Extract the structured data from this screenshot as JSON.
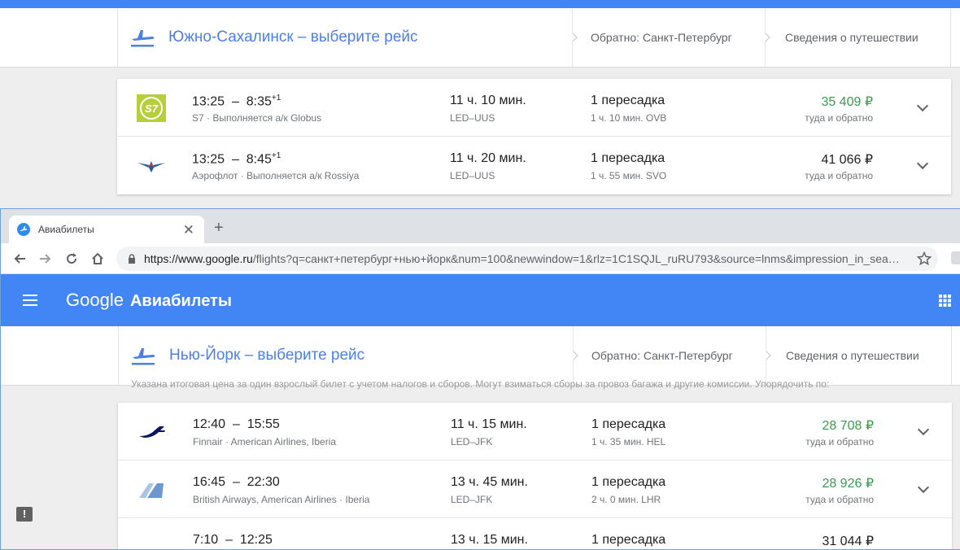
{
  "back": {
    "progress": {
      "destination": "Южно-Сахалинск – выберите рейс",
      "return": "Обратно: Санкт-Петербург",
      "details": "Сведения о путешествии"
    },
    "flights": [
      {
        "depart": "13:25",
        "arrive": "8:35",
        "plus_day": "+1",
        "airline": "S7 · Выполняется а/к Globus",
        "duration": "11 ч. 10 мин.",
        "route": "LED–UUS",
        "stops": "1 пересадка",
        "layover": "1 ч. 10 мин. OVB",
        "price": "35 409 ₽",
        "price_note": "туда и обратно",
        "logo": "s7-logo",
        "logo_text": "S7"
      },
      {
        "depart": "13:25",
        "arrive": "8:45",
        "plus_day": "+1",
        "airline": "Аэрофлот · Выполняется а/к Rossiya",
        "duration": "11 ч. 20 мин.",
        "route": "LED–UUS",
        "stops": "1 пересадка",
        "layover": "1 ч. 55 мин. SVO",
        "price": "41 066 ₽",
        "price_note": "туда и обратно",
        "logo": "aeroflot-logo"
      }
    ]
  },
  "browser": {
    "tab_title": "Авиабилеты",
    "url_host": "https://www.google.ru",
    "url_rest": "/flights?q=санкт+петербург+нью+йорк&num=100&newwindow=1&rlz=1C1SQJL_ruRU793&source=lnms&impression_in_sea…"
  },
  "app": {
    "brand": "Google",
    "service": "Авиабилеты",
    "progress": {
      "destination": "Нью-Йорк – выберите рейс",
      "return": "Обратно: Санкт-Петербург",
      "details": "Сведения о путешествии"
    },
    "smudge": "Указана итоговая цена за один взрослый билет с учетом налогов и сборов. Могут взиматься сборы за провоз багажа и другие комиссии.      Упорядочить по:",
    "flights": [
      {
        "depart": "12:40",
        "arrive": "15:55",
        "airline": "Finnair · American Airlines, Iberia",
        "duration": "11 ч. 15 мин.",
        "route": "LED–JFK",
        "stops": "1 пересадка",
        "layover": "1 ч. 35 мин. HEL",
        "price": "28 708 ₽",
        "price_note": "туда и обратно",
        "logo": "finnair-logo"
      },
      {
        "depart": "16:45",
        "arrive": "22:30",
        "airline": "British Airways, American Airlines · Iberia",
        "duration": "13 ч. 45 мин.",
        "route": "LED–JFK",
        "stops": "1 пересадка",
        "layover": "2 ч. 0 мин. LHR",
        "price": "28 926 ₽",
        "price_note": "туда и обратно",
        "logo": "british-airways-logo"
      },
      {
        "depart": "7:10",
        "arrive": "12:25",
        "duration": "13 ч. 15 мин.",
        "stops": "1 пересадка",
        "price": "31 044 ₽"
      }
    ]
  },
  "colors": {
    "accent": "#4285f4",
    "link": "#4d80e4",
    "price_green": "#3c9a50"
  }
}
